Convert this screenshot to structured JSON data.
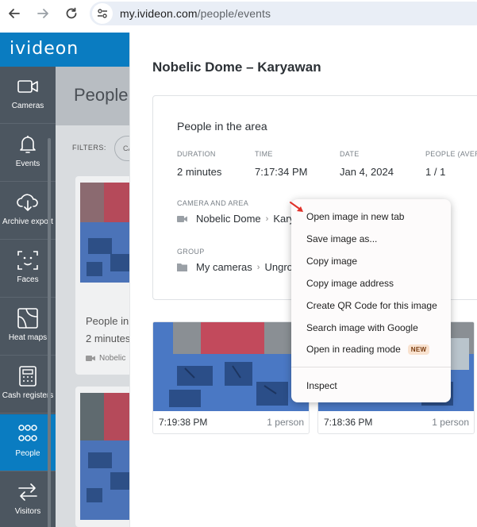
{
  "browser": {
    "url_host": "my.ivideon.com",
    "url_path": "/people/events"
  },
  "app": {
    "logo": "ivideon"
  },
  "sidebar": {
    "items": [
      {
        "label": "Cameras",
        "icon": "camera-icon"
      },
      {
        "label": "Events",
        "icon": "bell-icon"
      },
      {
        "label": "Archive export",
        "icon": "cloud-download-icon"
      },
      {
        "label": "Faces",
        "icon": "face-scan-icon"
      },
      {
        "label": "Heat maps",
        "icon": "heat-map-icon"
      },
      {
        "label": "Cash registers",
        "icon": "cash-register-icon"
      },
      {
        "label": "People",
        "icon": "people-icon",
        "active": true
      },
      {
        "label": "Visitors",
        "icon": "arrows-exchange-icon"
      }
    ],
    "active_color": "#0a7cc1"
  },
  "background_page": {
    "title": "People",
    "filters_label": "FILTERS:",
    "chip_label": "CA",
    "card": {
      "title": "People in",
      "duration": "2 minutes",
      "camera": "Nobelic"
    }
  },
  "panel": {
    "title": "Nobelic Dome – Karyawan",
    "card_heading": "People in the area",
    "columns": [
      {
        "label": "DURATION",
        "value": "2 minutes"
      },
      {
        "label": "TIME",
        "value": "7:17:34 PM"
      },
      {
        "label": "DATE",
        "value": "Jan 4, 2024"
      },
      {
        "label": "PEOPLE (AVER",
        "value": "1 / 1"
      }
    ],
    "camera_area_label": "CAMERA AND AREA",
    "camera_name": "Nobelic Dome",
    "area_name": "Karya",
    "group_label": "GROUP",
    "group_name": "My cameras",
    "group_sub": "Ungrou",
    "snapshots": [
      {
        "time": "7:19:38 PM",
        "count": "1 person"
      },
      {
        "time": "7:18:36 PM",
        "count": "1 person"
      }
    ]
  },
  "context_menu": {
    "items": [
      "Open image in new tab",
      "Save image as...",
      "Copy image",
      "Copy image address",
      "Create QR Code for this image",
      "Search image with Google",
      "Open in reading mode"
    ],
    "new_badge": "NEW",
    "inspect": "Inspect"
  }
}
